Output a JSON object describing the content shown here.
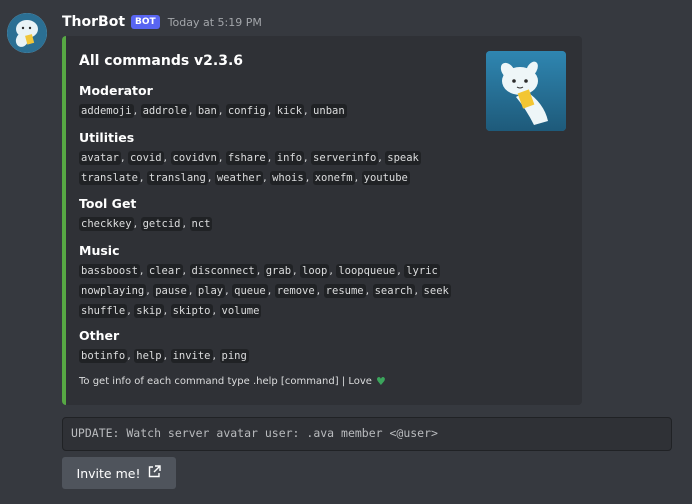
{
  "message": {
    "username": "ThorBot",
    "bot_tag": "BOT",
    "timestamp": "Today at 5:19 PM"
  },
  "embed": {
    "accent_color": "#57a844",
    "title": "All commands v2.3.6",
    "fields": [
      {
        "name": "Moderator",
        "lines": [
          [
            "addemoji",
            "addrole",
            "ban",
            "config",
            "kick",
            "unban"
          ]
        ]
      },
      {
        "name": "Utilities",
        "lines": [
          [
            "avatar",
            "covid",
            "covidvn",
            "fshare",
            "info",
            "serverinfo",
            "speak"
          ],
          [
            "translate",
            "translang",
            "weather",
            "whois",
            "xonefm",
            "youtube"
          ]
        ]
      },
      {
        "name": "Tool Get",
        "lines": [
          [
            "checkkey",
            "getcid",
            "nct"
          ]
        ]
      },
      {
        "name": "Music",
        "lines": [
          [
            "bassboost",
            "clear",
            "disconnect",
            "grab",
            "loop",
            "loopqueue",
            "lyric"
          ],
          [
            "nowplaying",
            "pause",
            "play",
            "queue",
            "remove",
            "resume",
            "search",
            "seek"
          ],
          [
            "shuffle",
            "skip",
            "skipto",
            "volume"
          ]
        ]
      },
      {
        "name": "Other",
        "lines": [
          [
            "botinfo",
            "help",
            "invite",
            "ping"
          ]
        ]
      }
    ],
    "footer": "To get info of each command type .help [command] | Love",
    "footer_icon": "green-heart-icon"
  },
  "update_text": "UPDATE: Watch server avatar user: .ava member <@user>",
  "invite_button": {
    "label": "Invite me!",
    "icon": "external-link-icon"
  }
}
